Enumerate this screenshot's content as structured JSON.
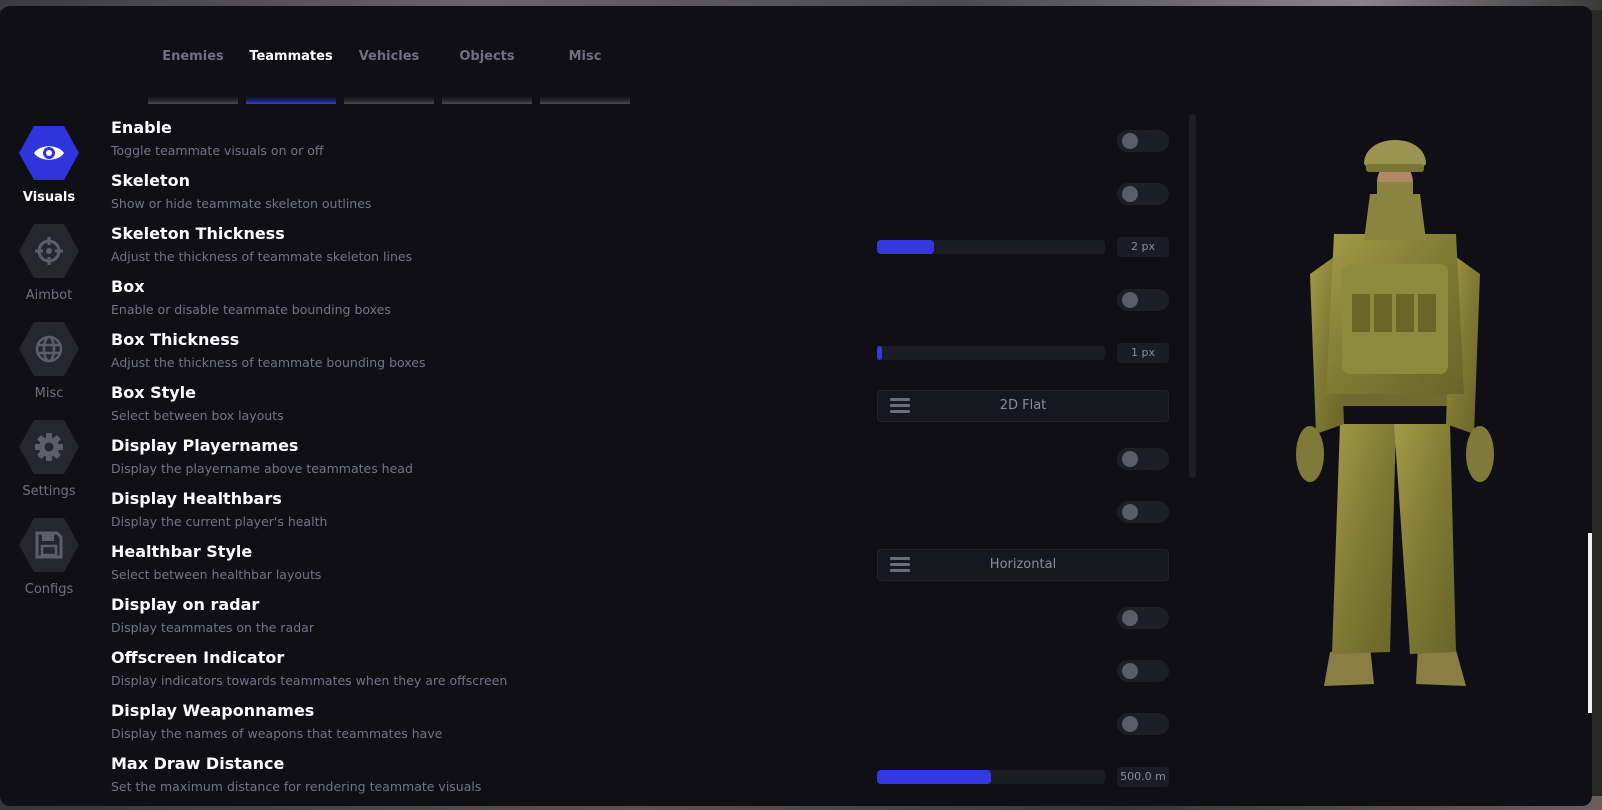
{
  "tabs": [
    {
      "label": "Enemies",
      "active": false
    },
    {
      "label": "Teammates",
      "active": true
    },
    {
      "label": "Vehicles",
      "active": false
    },
    {
      "label": "Objects",
      "active": false
    },
    {
      "label": "Misc",
      "active": false
    }
  ],
  "sidebar": {
    "items": [
      {
        "label": "Visuals",
        "icon": "eye-icon",
        "active": true
      },
      {
        "label": "Aimbot",
        "icon": "crosshair-icon",
        "active": false
      },
      {
        "label": "Misc",
        "icon": "globe-icon",
        "active": false
      },
      {
        "label": "Settings",
        "icon": "gear-icon",
        "active": false
      },
      {
        "label": "Configs",
        "icon": "floppy-disk-icon",
        "active": false
      }
    ]
  },
  "settings": [
    {
      "title": "Enable",
      "desc": "Toggle teammate visuals on or off",
      "control": "toggle",
      "on": false
    },
    {
      "title": "Skeleton",
      "desc": "Show or hide teammate skeleton outlines",
      "control": "toggle",
      "on": false
    },
    {
      "title": "Skeleton Thickness",
      "desc": "Adjust the thickness of teammate skeleton lines",
      "control": "slider",
      "value_label": "2 px",
      "fraction": 0.25
    },
    {
      "title": "Box",
      "desc": "Enable or disable teammate bounding boxes",
      "control": "toggle",
      "on": false
    },
    {
      "title": "Box Thickness",
      "desc": "Adjust the thickness of teammate bounding boxes",
      "control": "slider",
      "value_label": "1 px",
      "fraction": 0.02
    },
    {
      "title": "Box Style",
      "desc": "Select between box layouts",
      "control": "dropdown",
      "selected": "2D Flat"
    },
    {
      "title": "Display Playernames",
      "desc": "Display the playername above teammates head",
      "control": "toggle",
      "on": false
    },
    {
      "title": "Display Healthbars",
      "desc": "Display the current player's health",
      "control": "toggle",
      "on": false
    },
    {
      "title": "Healthbar Style",
      "desc": "Select between healthbar layouts",
      "control": "dropdown",
      "selected": "Horizontal"
    },
    {
      "title": "Display on radar",
      "desc": "Display teammates on the radar",
      "control": "toggle",
      "on": false
    },
    {
      "title": "Offscreen Indicator",
      "desc": "Display indicators towards teammates when they are offscreen",
      "control": "toggle",
      "on": false
    },
    {
      "title": "Display Weaponnames",
      "desc": "Display the names of weapons that teammates have",
      "control": "toggle",
      "on": false
    },
    {
      "title": "Max Draw Distance",
      "desc": "Set the maximum distance for rendering teammate visuals",
      "control": "slider",
      "value_label": "500.0 m",
      "fraction": 0.5
    }
  ],
  "colors": {
    "accent": "#3438e0",
    "panel": "#0f0f15",
    "muted_text": "#727487"
  }
}
